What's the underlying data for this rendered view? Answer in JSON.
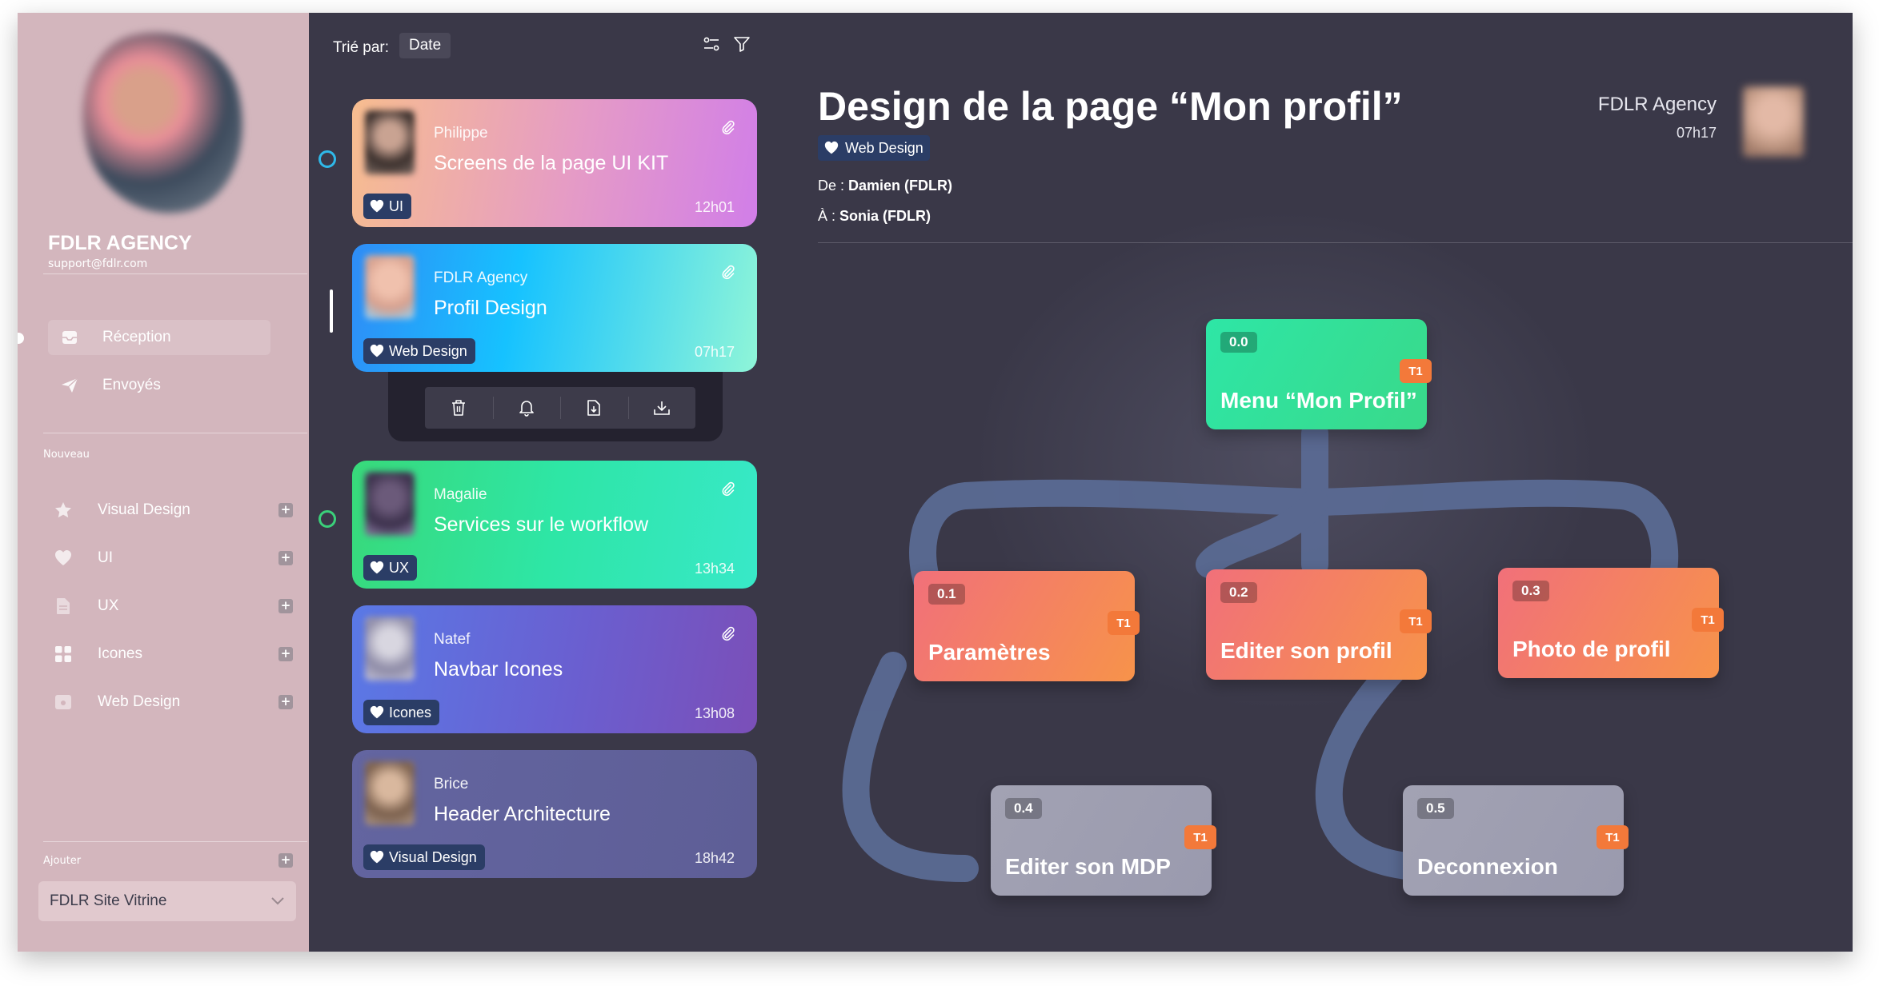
{
  "sidebar": {
    "brand": "FDLR AGENCY",
    "email": "support@fdlr.com",
    "nav": [
      {
        "label": "Réception",
        "icon": "inbox-icon",
        "active": true
      },
      {
        "label": "Envoyés",
        "icon": "send-icon",
        "active": false
      }
    ],
    "new_section": "Nouveau",
    "categories": [
      {
        "label": "Visual Design",
        "icon": "star-icon"
      },
      {
        "label": "UI",
        "icon": "heart-icon"
      },
      {
        "label": "UX",
        "icon": "document-icon"
      },
      {
        "label": "Icones",
        "icon": "grid-icon"
      },
      {
        "label": "Web Design",
        "icon": "browser-icon"
      }
    ],
    "add_section": "Ajouter",
    "project_select": "FDLR  Site Vitrine"
  },
  "list": {
    "sort_label": "Trié par:",
    "sort_value": "Date",
    "cards": [
      {
        "sender": "Philippe",
        "title": "Screens de la page UI KIT",
        "tag": "UI",
        "time": "12h01"
      },
      {
        "sender": "FDLR Agency",
        "title": "Profil Design",
        "tag": "Web Design",
        "time": "07h17"
      },
      {
        "sender": "Magalie",
        "title": "Services  sur le workflow",
        "tag": "UX",
        "time": "13h34"
      },
      {
        "sender": "Natef",
        "title": "Navbar Icones",
        "tag": "Icones",
        "time": "13h08"
      },
      {
        "sender": "Brice",
        "title": "Header Architecture",
        "tag": "Visual Design",
        "time": "18h42"
      }
    ],
    "actions": [
      "trash-icon",
      "bell-icon",
      "file-download-icon",
      "download-icon"
    ]
  },
  "detail": {
    "title": "Design de la page “Mon profil”",
    "tag": "Web Design",
    "from_label": "De : ",
    "from_value": "Damien (FDLR)",
    "to_label": "À : ",
    "to_value": "Sonia (FDLR)",
    "agency": "FDLR Agency",
    "time": "07h17",
    "nodes": [
      {
        "id": "0.0",
        "label": "Menu “Mon Profil”",
        "badge": "T1"
      },
      {
        "id": "0.1",
        "label": "Paramètres",
        "badge": "T1"
      },
      {
        "id": "0.2",
        "label": "Editer son profil",
        "badge": "T1"
      },
      {
        "id": "0.3",
        "label": "Photo de profil",
        "badge": "T1"
      },
      {
        "id": "0.4",
        "label": "Editer son MDP",
        "badge": "T1"
      },
      {
        "id": "0.5",
        "label": "Deconnexion",
        "badge": "T1"
      }
    ]
  },
  "colors": {
    "sidebar_bg": "#d3b6bd",
    "panel_bg": "#3a3848",
    "tag_bg": "#2b3d66",
    "badge_orange": "#f3793a",
    "radio_blue": "#2fb8e8",
    "radio_green": "#3ad07a"
  }
}
